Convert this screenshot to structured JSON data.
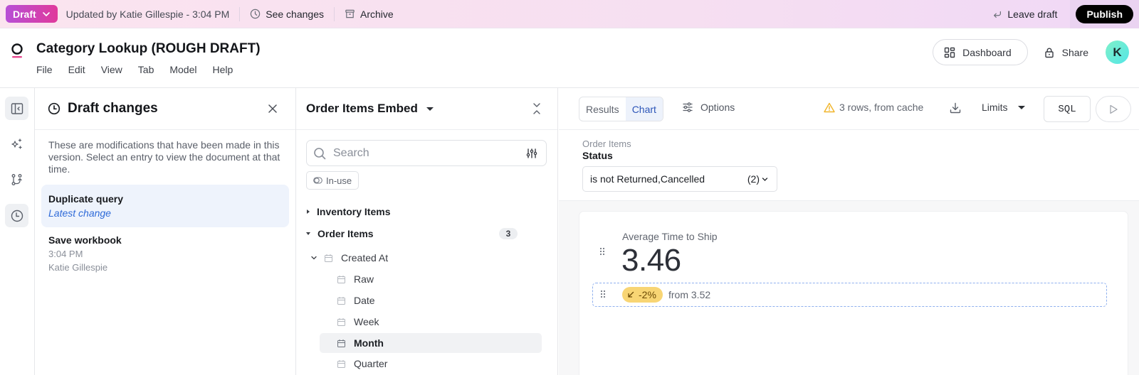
{
  "banner": {
    "draft_label": "Draft",
    "updated_text": "Updated by Katie Gillespie - 3:04 PM",
    "see_changes_label": "See changes",
    "archive_label": "Archive",
    "leave_draft_label": "Leave draft",
    "publish_label": "Publish"
  },
  "header": {
    "title": "Category Lookup (ROUGH DRAFT)",
    "menu": [
      "File",
      "Edit",
      "View",
      "Tab",
      "Model",
      "Help"
    ],
    "dashboard_label": "Dashboard",
    "share_label": "Share",
    "avatar_initial": "K"
  },
  "rail": {
    "items": [
      {
        "icon": "sidebar-collapse-icon",
        "active": true
      },
      {
        "icon": "sparkles-icon",
        "active": false
      },
      {
        "icon": "git-branch-icon",
        "active": false
      },
      {
        "icon": "history-clock-icon",
        "active": true
      }
    ]
  },
  "draft_panel": {
    "title": "Draft changes",
    "description": "These are modifications that have been made in this version. Select an entry to view the document at that time.",
    "changes": [
      {
        "title": "Duplicate query",
        "subtitle": "Latest change",
        "selected": true
      },
      {
        "title": "Save workbook",
        "time": "3:04 PM",
        "author": "Katie Gillespie",
        "selected": false
      }
    ]
  },
  "data_panel": {
    "title": "Order Items Embed",
    "search_placeholder": "Search",
    "in_use_label": "In-use",
    "tree": {
      "inventory_items": "Inventory Items",
      "order_items": "Order Items",
      "order_items_count": "3",
      "created_at": "Created At",
      "children": [
        "Raw",
        "Date",
        "Week",
        "Month",
        "Quarter"
      ],
      "highlighted": "Month"
    }
  },
  "toolbar": {
    "tabs": [
      "Results",
      "Chart"
    ],
    "active_tab": "Chart",
    "options_label": "Options",
    "cache_status": "3 rows, from cache",
    "limits_label": "Limits",
    "sql_label": "SQL"
  },
  "filter": {
    "source": "Order Items",
    "field": "Status",
    "value": "is not Returned,Cancelled",
    "count": "(2)"
  },
  "kpi": {
    "label": "Average Time to Ship",
    "value": "3.46",
    "delta": "-2%",
    "comparison": "from 3.52"
  },
  "colors": {
    "draft_gradient_start": "#b74fd6",
    "draft_gradient_end": "#e0399b",
    "accent_blue": "#2c55b8",
    "delta_badge": "#f8d574",
    "warning": "#f0b429"
  }
}
